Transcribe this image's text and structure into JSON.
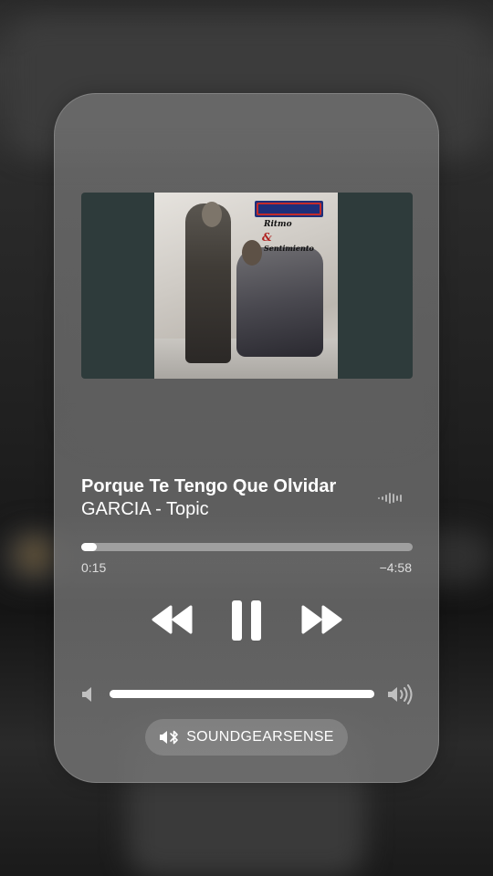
{
  "now_playing": {
    "title": "Porque Te Tengo Que Olvidar",
    "artist": "GARCIA - Topic",
    "artwork": {
      "band_logo": "GARCIA",
      "album_line1": "Ritmo",
      "album_line2": "&",
      "album_line3": "Sentimiento"
    }
  },
  "playback": {
    "elapsed": "0:15",
    "remaining": "−4:58",
    "progress_fraction": 0.048
  },
  "volume": {
    "level_fraction": 1.0
  },
  "output": {
    "device_label": "SOUNDGEARSENSE",
    "icon": "bluetooth-speaker-icon"
  },
  "colors": {
    "text": "#ffffff",
    "track": "#d2d2d2",
    "fill": "#ffffff"
  }
}
